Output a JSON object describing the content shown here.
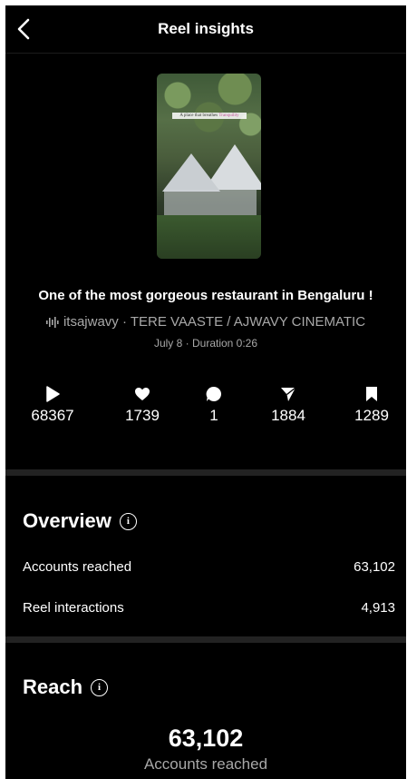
{
  "header": {
    "title": "Reel insights"
  },
  "thumbnail": {
    "caption_prefix": "A place that breathes",
    "caption_accent": "Tranquility"
  },
  "reel": {
    "title": "One of the most gorgeous restaurant in Bengaluru !",
    "audio": "itsajwavy · TERE VAASTE / AJWAVY CINEMATIC",
    "meta": "July 8 · Duration 0:26"
  },
  "stats": [
    {
      "icon": "play-icon",
      "value": "68367"
    },
    {
      "icon": "heart-icon",
      "value": "1739"
    },
    {
      "icon": "comment-icon",
      "value": "1"
    },
    {
      "icon": "share-icon",
      "value": "1884"
    },
    {
      "icon": "bookmark-icon",
      "value": "1289"
    }
  ],
  "overview": {
    "title": "Overview",
    "rows": [
      {
        "label": "Accounts reached",
        "value": "63,102"
      },
      {
        "label": "Reel interactions",
        "value": "4,913"
      }
    ]
  },
  "reach": {
    "title": "Reach",
    "value": "63,102",
    "label": "Accounts reached"
  },
  "colors": {
    "background": "#000000",
    "secondary_text": "#a8a8a8",
    "separator": "#222222"
  }
}
